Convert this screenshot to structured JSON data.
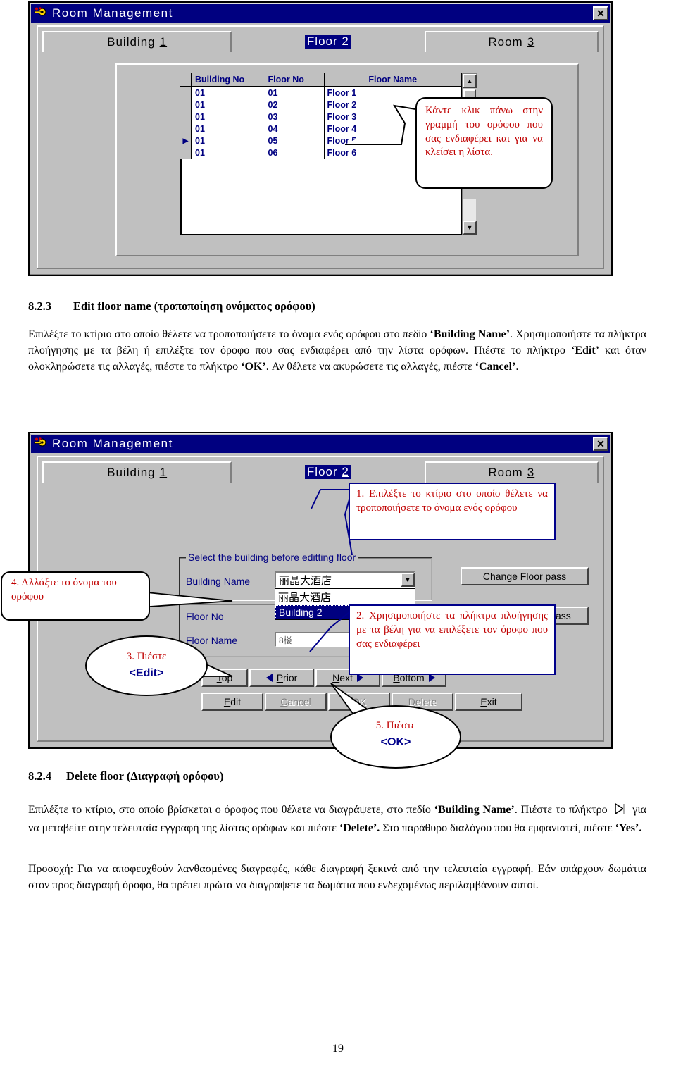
{
  "window": {
    "title": "Room Management",
    "icon": "key-icon",
    "close_label": "✕",
    "tabs": [
      {
        "label": "Building",
        "accel": "1",
        "name": "building"
      },
      {
        "label": "Floor",
        "accel": "2",
        "name": "floor"
      },
      {
        "label": "Room",
        "accel": "3",
        "name": "room"
      }
    ]
  },
  "grid": {
    "columns": [
      "Building No",
      "Floor No",
      "Floor Name"
    ],
    "rows": [
      {
        "marker": "",
        "building_no": "01",
        "floor_no": "01",
        "floor_name": "Floor 1"
      },
      {
        "marker": "",
        "building_no": "01",
        "floor_no": "02",
        "floor_name": "Floor 2"
      },
      {
        "marker": "",
        "building_no": "01",
        "floor_no": "03",
        "floor_name": "Floor 3"
      },
      {
        "marker": "",
        "building_no": "01",
        "floor_no": "04",
        "floor_name": "Floor 4"
      },
      {
        "marker": "▶",
        "building_no": "01",
        "floor_no": "05",
        "floor_name": "Floor 5"
      },
      {
        "marker": "",
        "building_no": "01",
        "floor_no": "06",
        "floor_name": "Floor 6"
      }
    ],
    "scroll_up_icon": "▲",
    "scroll_down_icon": "▼"
  },
  "callout_top": {
    "text": "Κάντε κλικ πάνω στην γραμμή του ορόφου που σας ενδιαφέρει και για να κλείσει η λίστα."
  },
  "section_823": {
    "number": "8.2.3",
    "title": "Edit floor name (τροποποίηση ονόματος ορόφου)",
    "paragraph_parts": [
      {
        "t": "Επιλέξτε το κτίριο στο οποίο θέλετε να τροποποιήσετε το όνομα ενός ορόφου στο πεδίο ",
        "b": false
      },
      {
        "t": "‘Building Name’",
        "b": true
      },
      {
        "t": ". Χρησιμοποιήστε τα πλήκτρα πλοήγησης με τα βέλη ή επιλέξτε τον όροφο που σας ενδιαφέρει από την λίστα ορόφων. Πιέστε το πλήκτρο ",
        "b": false
      },
      {
        "t": "‘Edit’",
        "b": true
      },
      {
        "t": " και όταν ολοκληρώσετε τις αλλαγές, πιέστε το πλήκτρο ",
        "b": false
      },
      {
        "t": "‘OK’",
        "b": true
      },
      {
        "t": ". Αν θέλετε να ακυρώσετε τις αλλαγές, πιέστε ",
        "b": false
      },
      {
        "t": "‘Cancel’",
        "b": true
      },
      {
        "t": ".",
        "b": false
      }
    ]
  },
  "form": {
    "groupbox_legend": "Select the building before editting floor",
    "fields": [
      {
        "label": "Building Name",
        "value": "丽晶大酒店",
        "type": "combobox"
      },
      {
        "label": "Floor No",
        "value": "",
        "type": "text"
      },
      {
        "label": "Floor Name",
        "value": "8楼",
        "type": "text"
      }
    ],
    "dropdown_open": true,
    "dropdown_options": [
      {
        "label": "丽晶大酒店",
        "selected": false
      },
      {
        "label": "Building 2",
        "selected": true
      }
    ],
    "dropdown_arrow_icon": "▼",
    "side_buttons": [
      {
        "label": "Change Floor pass",
        "name": "change-floor-pass"
      },
      {
        "label": "Download Floor pass",
        "name": "download-floor-pass"
      }
    ],
    "nav_buttons": [
      {
        "label": "Top",
        "accel_index": 0,
        "arrow": "none",
        "name": "top"
      },
      {
        "label": "Prior",
        "accel_index": 0,
        "arrow": "left",
        "name": "prior"
      },
      {
        "label": "Next",
        "accel_index": 0,
        "arrow": "right",
        "name": "next"
      },
      {
        "label": "Bottom",
        "accel_index": 0,
        "arrow": "right",
        "name": "bottom"
      }
    ],
    "action_buttons": [
      {
        "label": "Edit",
        "accel": "E",
        "disabled": false,
        "name": "edit"
      },
      {
        "label": "Cancel",
        "accel": "C",
        "disabled": true,
        "name": "cancel"
      },
      {
        "label": "OK",
        "accel": "O",
        "disabled": true,
        "name": "ok"
      },
      {
        "label": "Delete",
        "accel": "D",
        "disabled": true,
        "name": "delete"
      },
      {
        "label": "Exit",
        "accel": "E",
        "disabled": false,
        "name": "exit"
      }
    ]
  },
  "callouts": {
    "one": "1. Επιλέξτε το κτίριο στο οποίο θέλετε να τροποποιήσετε το όνομα ενός ορόφου",
    "two": "2. Χρησιμοποιήστε τα πλήκτρα πλοήγησης με τα βέλη για να επιλέξετε τον όροφο που σας ενδιαφέρει",
    "three_line1": "3. Πιέστε",
    "three_line2": "<Edit>",
    "four": "4. Αλλάξτε το όνομα του ορόφου",
    "five_line1": "5. Πιέστε",
    "five_line2": "<OK>"
  },
  "section_824": {
    "number": "8.2.4",
    "title": "Delete floor (Διαγραφή ορόφου)",
    "p1_a": "Επιλέξτε το κτίριο, στο οποίο βρίσκεται ο όροφος που θέλετε να διαγράψετε, στο πεδίο ",
    "p1_b1": "‘Building Name’",
    "p1_c": ". Πιέστε το πλήκτρο ",
    "p1_icon": "next-record-triangle-icon",
    "p1_d": " για να μεταβείτε στην τελευταία εγγραφή της λίστας ορόφων και πιέστε ",
    "p1_b2": "‘Delete’.",
    "p1_e": " Στο παράθυρο διαλόγου που θα εμφανιστεί, πιέστε ",
    "p1_b3": "‘Yes’.",
    "p2": "Προσοχή: Για να αποφευχθούν λανθασμένες διαγραφές, κάθε διαγραφή ξεκινά από την τελευταία εγγραφή. Εάν υπάρχουν δωμάτια στον προς διαγραφή όροφο, θα πρέπει πρώτα να διαγράψετε τα δωμάτια που ενδεχομένως περιλαμβάνουν αυτοί."
  },
  "footer": {
    "page_number": "19"
  },
  "colors": {
    "titlebar": "#000080",
    "face": "#c0c0c0",
    "grid_text": "#000080",
    "callout_red": "#c00000",
    "callout_blue": "#00008b"
  }
}
